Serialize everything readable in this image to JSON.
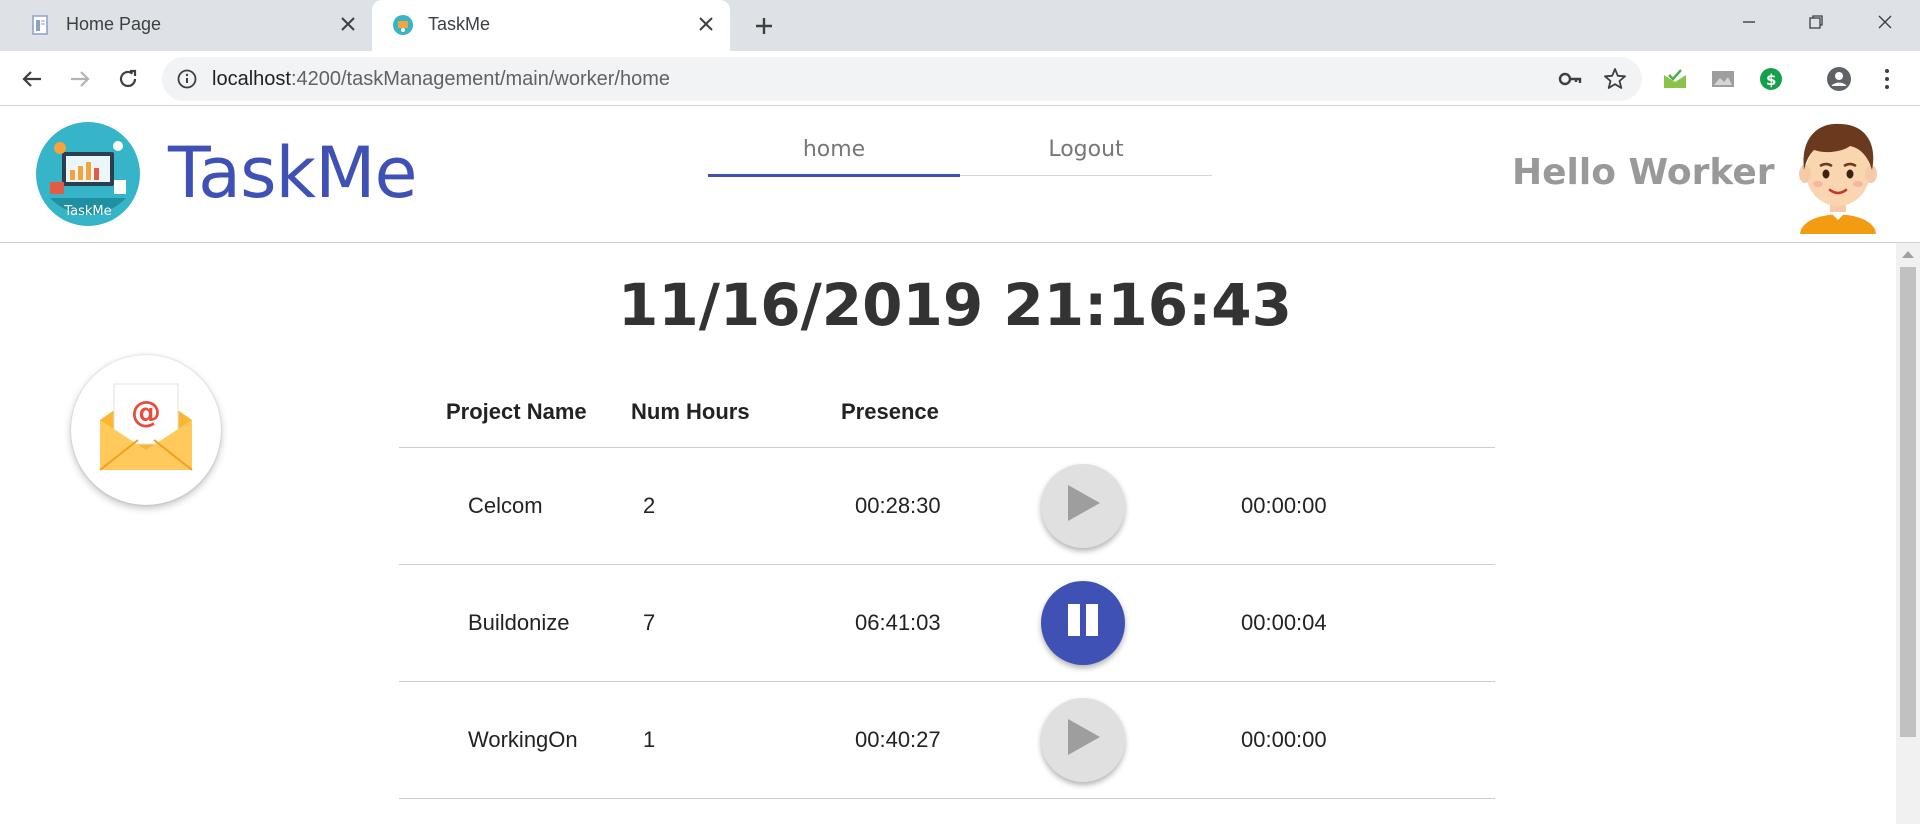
{
  "browser": {
    "tabs": [
      {
        "title": "Home Page",
        "active": false
      },
      {
        "title": "TaskMe",
        "active": true
      }
    ],
    "url_host": "localhost",
    "url_rest": ":4200/taskManagement/main/worker/home"
  },
  "header": {
    "brand": "TaskMe",
    "logo_text": "TaskMe",
    "nav": [
      {
        "label": "home",
        "active": true
      },
      {
        "label": "Logout",
        "active": false
      }
    ],
    "greeting": "Hello Worker"
  },
  "main": {
    "clock": "11/16/2019 21:16:43",
    "table": {
      "columns": [
        "Project Name",
        "Num Hours",
        "Presence"
      ],
      "rows": [
        {
          "project": "Celcom",
          "hours": "2",
          "presence": "00:28:30",
          "state": "play",
          "timer": "00:00:00"
        },
        {
          "project": "Buildonize",
          "hours": "7",
          "presence": "06:41:03",
          "state": "pause",
          "timer": "00:00:04"
        },
        {
          "project": "WorkingOn",
          "hours": "1",
          "presence": "00:40:27",
          "state": "play",
          "timer": "00:00:00"
        }
      ]
    }
  },
  "colors": {
    "primary": "#3f51b5",
    "idle_button": "#e0e0e0"
  }
}
